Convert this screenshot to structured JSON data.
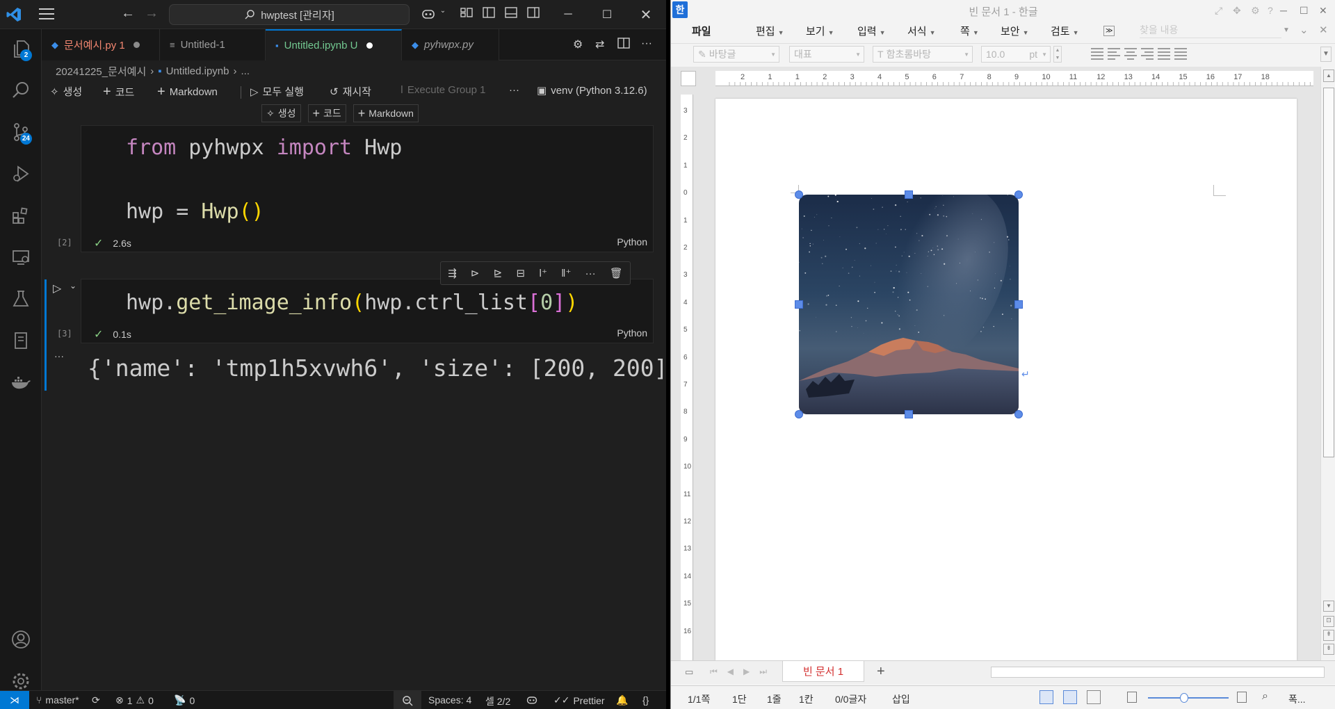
{
  "vscode": {
    "search_text": "hwptest [관리자]",
    "tabs": [
      {
        "label": "문서예시.py 1",
        "color": "#f48771",
        "dot": "#8b8b8b"
      },
      {
        "label": "Untitled-1",
        "color": "#9d9d9d"
      },
      {
        "label": "Untitled.ipynb U",
        "color": "#73c991",
        "dot": "#ffffff"
      },
      {
        "label": "pyhwpx.py",
        "color": "#9d9d9d"
      }
    ],
    "breadcrumb": [
      "20241225_문서예시",
      "Untitled.ipynb",
      "..."
    ],
    "toolbar": {
      "generate": "생성",
      "code": "코드",
      "markdown": "Markdown",
      "run_all": "모두 실행",
      "restart": "재시작",
      "execute_group": "Execute Group 1",
      "more": "···",
      "kernel": "venv (Python 3.12.6)"
    },
    "insert_bar": {
      "generate": "생성",
      "code": "코드",
      "markdown": "Markdown"
    },
    "cells": [
      {
        "exec_count": "[2]",
        "time": "2.6s",
        "lang": "Python",
        "line1": {
          "kw1": "from",
          "mod": " pyhwpx ",
          "kw2": "import",
          "name": " Hwp"
        },
        "line2": {
          "var": "hwp = ",
          "fn": "Hwp",
          "paren": "()"
        }
      },
      {
        "exec_count": "[3]",
        "time": "0.1s",
        "lang": "Python",
        "code": {
          "obj": "hwp.",
          "fn": "get_image_info",
          "p_open": "(",
          "arg": "hwp.ctrl_list",
          "b_open": "[",
          "idx": "0",
          "b_close": "]",
          "p_close": ")"
        }
      }
    ],
    "output_ellipsis": "···",
    "output_text": "{'name': 'tmp1h5xvwh6', 'size': [200, 200]}",
    "activity_badges": {
      "explorer": "2",
      "scm": "24"
    },
    "status": {
      "branch": "master*",
      "errors": "1",
      "warnings": "0",
      "ports": "0",
      "spaces": "Spaces: 4",
      "cell": "셀 2/2",
      "prettier": "Prettier",
      "braces": "{}"
    }
  },
  "hwp": {
    "logo": "한",
    "title": "빈 문서 1 - 한글",
    "menu": [
      "파일",
      "편집",
      "보기",
      "입력",
      "서식",
      "쪽",
      "보안",
      "검토"
    ],
    "menu_search": "찾을 내용",
    "format": {
      "style": "바탕글",
      "lang": "대표",
      "font": "함초롬바탕",
      "size": "10.0",
      "unit": "pt"
    },
    "ruler_h": [
      "2",
      "1",
      "1",
      "2",
      "3",
      "4",
      "5",
      "6",
      "7",
      "8",
      "9",
      "10",
      "11",
      "12",
      "13",
      "14",
      "15",
      "16",
      "17",
      "18"
    ],
    "ruler_v": [
      "3",
      "2",
      "1",
      "0",
      "1",
      "2",
      "3",
      "4",
      "5",
      "6",
      "7",
      "8",
      "9",
      "10",
      "11",
      "12",
      "13",
      "14",
      "15",
      "16"
    ],
    "doc_tab": "빈 문서 1",
    "status": {
      "page": "1/1쪽",
      "column": "1단",
      "line": "1줄",
      "col": "1칸",
      "chars": "0/0글자",
      "mode": "삽입",
      "zoom_label": "폭..."
    }
  }
}
